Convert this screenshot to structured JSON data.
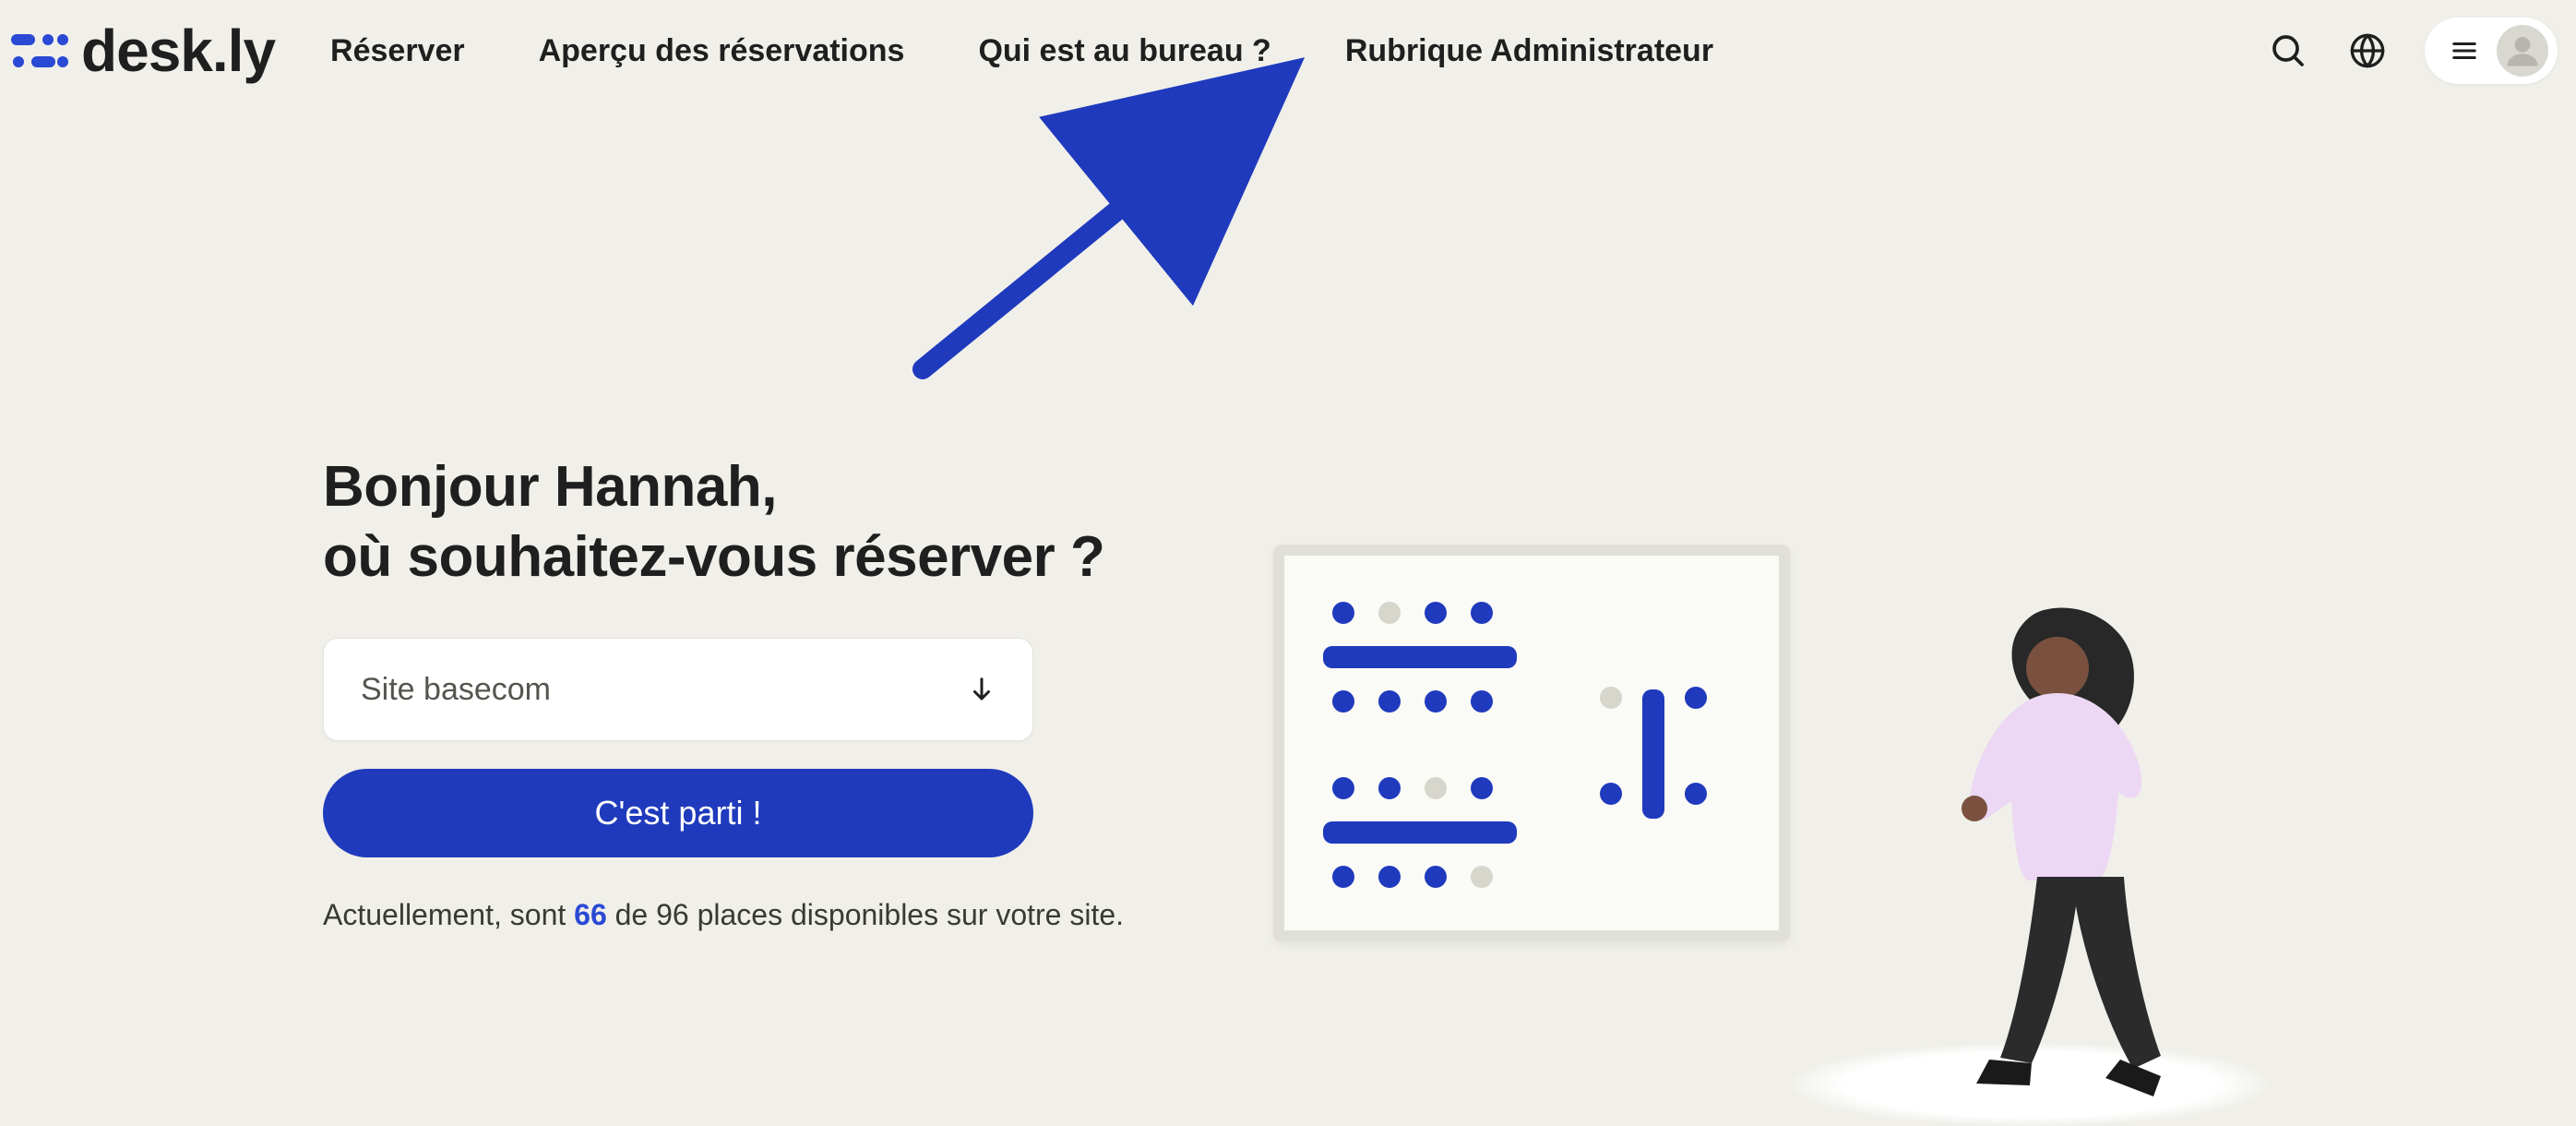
{
  "brand": {
    "name": "desk.ly"
  },
  "nav": {
    "reserve": "Réserver",
    "overview": "Aperçu des réservations",
    "who": "Qui est au bureau ?",
    "admin": "Rubrique Administrateur"
  },
  "greeting": {
    "line1": "Bonjour Hannah,",
    "line2": "où souhaitez-vous réserver ?"
  },
  "site_select": {
    "value": "Site basecom"
  },
  "cta": {
    "label": "C'est parti !"
  },
  "availability": {
    "prefix": "Actuellement, sont ",
    "available": "66",
    "middle": " de 96 places disponibles sur votre site."
  },
  "colors": {
    "accent": "#1f3abd",
    "background": "#f0efe9"
  }
}
